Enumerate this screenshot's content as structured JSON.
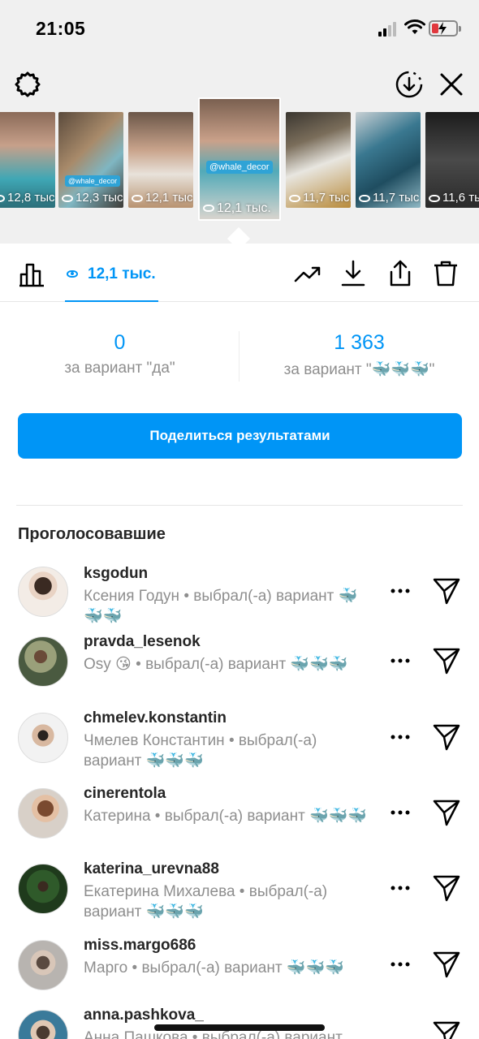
{
  "status_bar": {
    "time": "21:05"
  },
  "stories": [
    {
      "views": "12,8 тыс."
    },
    {
      "views": "12,3 тыс.",
      "tag": "@whale_decor"
    },
    {
      "views": "12,1 тыс."
    },
    {
      "views": "12,1 тыс.",
      "tag": "@whale_decor",
      "selected": true
    },
    {
      "views": "11,7 тыс."
    },
    {
      "views": "11,7 тыс."
    },
    {
      "views": "11,6 тыс."
    }
  ],
  "toolbar": {
    "views_label": "12,1 тыс."
  },
  "results": {
    "option1": {
      "count": "0",
      "caption": "за вариант \"да\""
    },
    "option2": {
      "count": "1 363",
      "caption": "за вариант \"🐳🐳🐳\""
    }
  },
  "share_button": "Поделиться результатами",
  "voters_title": "Проголосовавшие",
  "voters": [
    {
      "username": "ksgodun",
      "detail": "Ксения Годун • выбрал(-а) вариант 🐳🐳🐳"
    },
    {
      "username": "pravda_lesenok",
      "detail": "Osy 😘 • выбрал(-а) вариант 🐳🐳🐳"
    },
    {
      "username": "chmelev.konstantin",
      "detail": "Чмелев Константин • выбрал(-а) вариант 🐳🐳🐳"
    },
    {
      "username": "cinerentola",
      "detail": "Катерина • выбрал(-а) вариант 🐳🐳🐳"
    },
    {
      "username": "katerina_urevna88",
      "detail": "Екатерина Михалева • выбрал(-а) вариант 🐳🐳🐳"
    },
    {
      "username": "miss.margo686",
      "detail": "Марго • выбрал(-а) вариант 🐳🐳🐳"
    },
    {
      "username": "anna.pashkova_",
      "detail": "Анна Пашкова • выбрал(-а) вариант"
    }
  ],
  "colors": {
    "accent": "#0095f6",
    "secondary_text": "#8e8e8e",
    "tag": "#2fa3d6"
  }
}
